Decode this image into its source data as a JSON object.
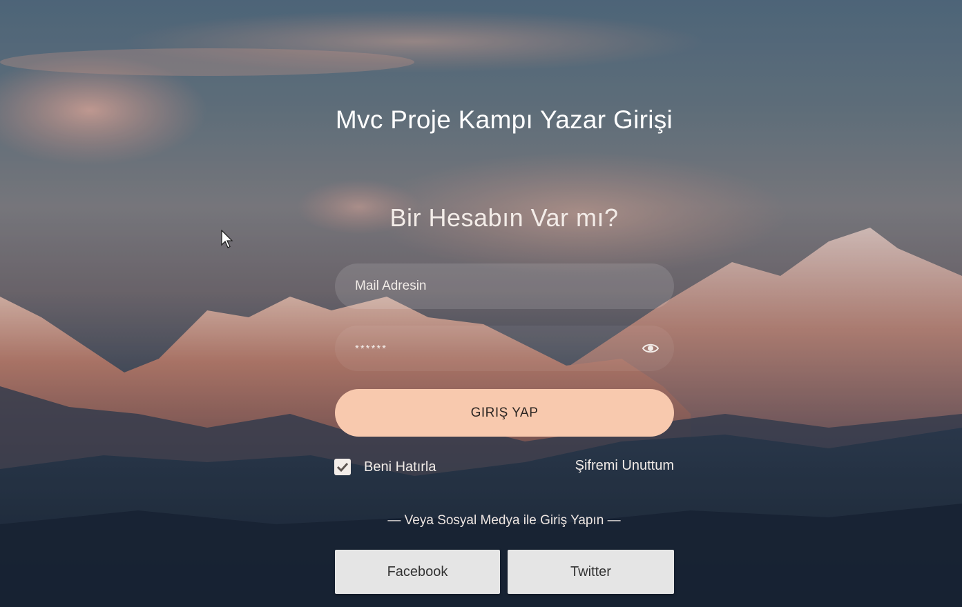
{
  "page": {
    "title": "Mvc Proje Kampı Yazar Girişi",
    "subtitle": "Bir Hesabın Var mı?"
  },
  "form": {
    "email_placeholder": "Mail Adresin",
    "email_value": "",
    "password_value": "******",
    "password_toggle_icon": "eye-icon",
    "login_label": "GIRIŞ YAP",
    "remember_label": "Beni Hatırla",
    "remember_checked": true,
    "forgot_label": "Şifremi Unuttum"
  },
  "social": {
    "divider_text": "— Veya Sosyal Medya ile Giriş Yapın —",
    "facebook_label": "Facebook",
    "twitter_label": "Twitter"
  },
  "colors": {
    "login_button": "#f8c9ae",
    "social_button": "#e5e5e5",
    "text": "#ffffff"
  }
}
